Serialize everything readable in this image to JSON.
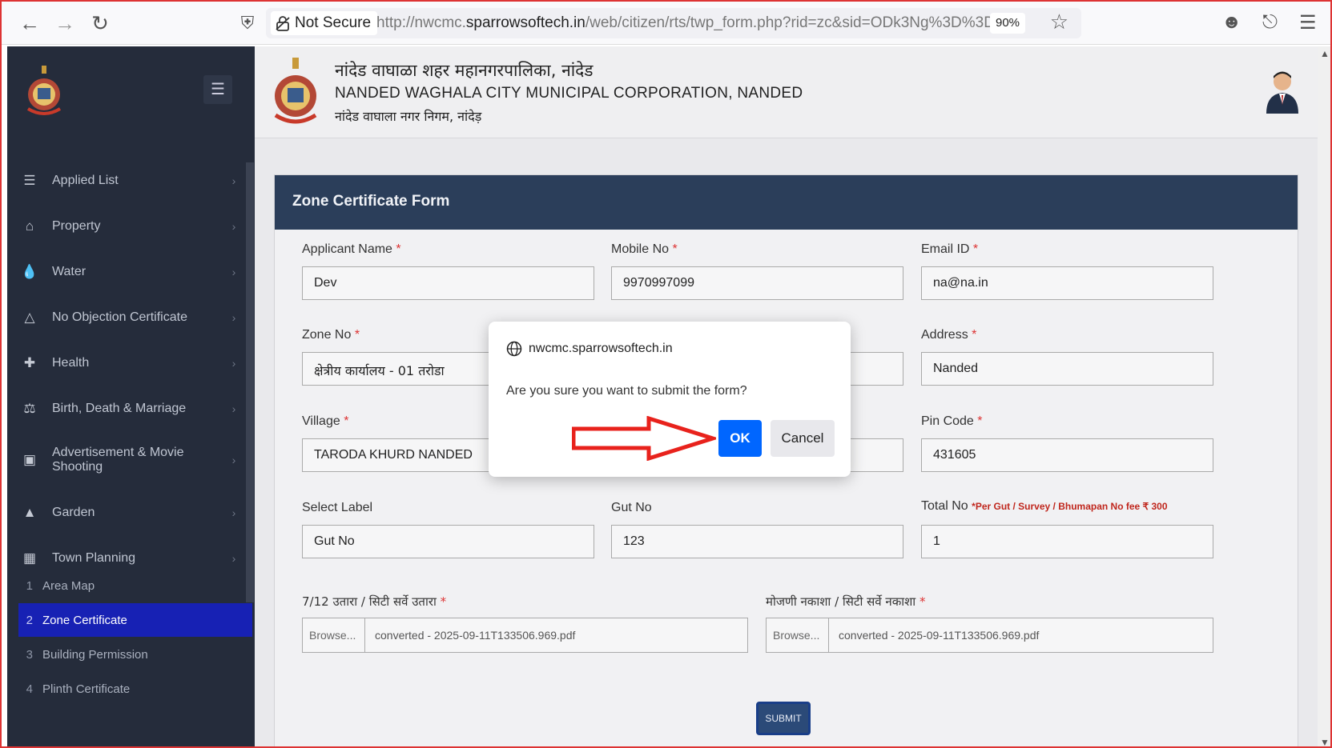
{
  "browser": {
    "security_label": "Not Secure",
    "url_prefix": "http://nwcmc.",
    "url_domain": "sparrowsoftech.in",
    "url_path": "/web/citizen/rts/twp_form.php?rid=zc&sid=ODk3Ng%3D%3D",
    "zoom": "90%"
  },
  "sidebar": {
    "items": [
      {
        "label": "Applied List",
        "icon": "list-icon"
      },
      {
        "label": "Property",
        "icon": "home-icon"
      },
      {
        "label": "Water",
        "icon": "water-drop-icon"
      },
      {
        "label": "No Objection Certificate",
        "icon": "fire-icon"
      },
      {
        "label": "Health",
        "icon": "hospital-icon"
      },
      {
        "label": "Birth, Death & Marriage",
        "icon": "family-icon"
      },
      {
        "label": "Advertisement & Movie Shooting",
        "icon": "ad-icon"
      },
      {
        "label": "Garden",
        "icon": "tree-icon"
      },
      {
        "label": "Town Planning",
        "icon": "city-icon"
      }
    ],
    "sub_items": [
      {
        "num": "1",
        "label": "Area Map"
      },
      {
        "num": "2",
        "label": "Zone Certificate"
      },
      {
        "num": "3",
        "label": "Building Permission"
      },
      {
        "num": "4",
        "label": "Plinth Certificate"
      }
    ]
  },
  "header": {
    "title_marathi": "नांदेड वाघाळा शहर महानगरपालिका, नांदेड",
    "title_english": "NANDED WAGHALA CITY MUNICIPAL CORPORATION, NANDED",
    "title_hindi": "नांदेड वाघाला नगर निगम, नांदेड़"
  },
  "form": {
    "title": "Zone Certificate Form",
    "applicant_name_label": "Applicant Name",
    "applicant_name": "Dev",
    "mobile_label": "Mobile No",
    "mobile": "9970997099",
    "email_label": "Email ID",
    "email": "na@na.in",
    "zone_label": "Zone No",
    "zone": "क्षेत्रीय कार्यालय - 01 तरोडा",
    "address_label": "Address",
    "address": "Nanded",
    "village_label": "Village",
    "village": "TARODA KHURD NANDED",
    "pin_label": "Pin Code",
    "pin": "431605",
    "select_label_label": "Select Label",
    "select_label": "Gut No",
    "gut_label": "Gut No",
    "gut": "123",
    "total_label": "Total No",
    "total_note": "*Per Gut / Survey / Bhumapan No fee ₹ 300",
    "total": "1",
    "file1_label": "7/12 उतारा / सिटी सर्वे उतारा",
    "file2_label": "मोजणी नकाशा / सिटी सर्वे नकाशा",
    "browse": "Browse...",
    "file1_name": "converted - 2025-09-11T133506.969.pdf",
    "file2_name": "converted - 2025-09-11T133506.969.pdf",
    "required_mark": "*",
    "submit": "SUBMIT"
  },
  "dialog": {
    "origin": "nwcmc.sparrowsoftech.in",
    "message": "Are you sure you want to submit the form?",
    "ok": "OK",
    "cancel": "Cancel"
  },
  "colors": {
    "sidebar_bg": "#252c3b",
    "card_header": "#2b3e5a",
    "active_item": "#1721b4",
    "ok_button": "#0066ff",
    "arrow": "#e8221c"
  }
}
